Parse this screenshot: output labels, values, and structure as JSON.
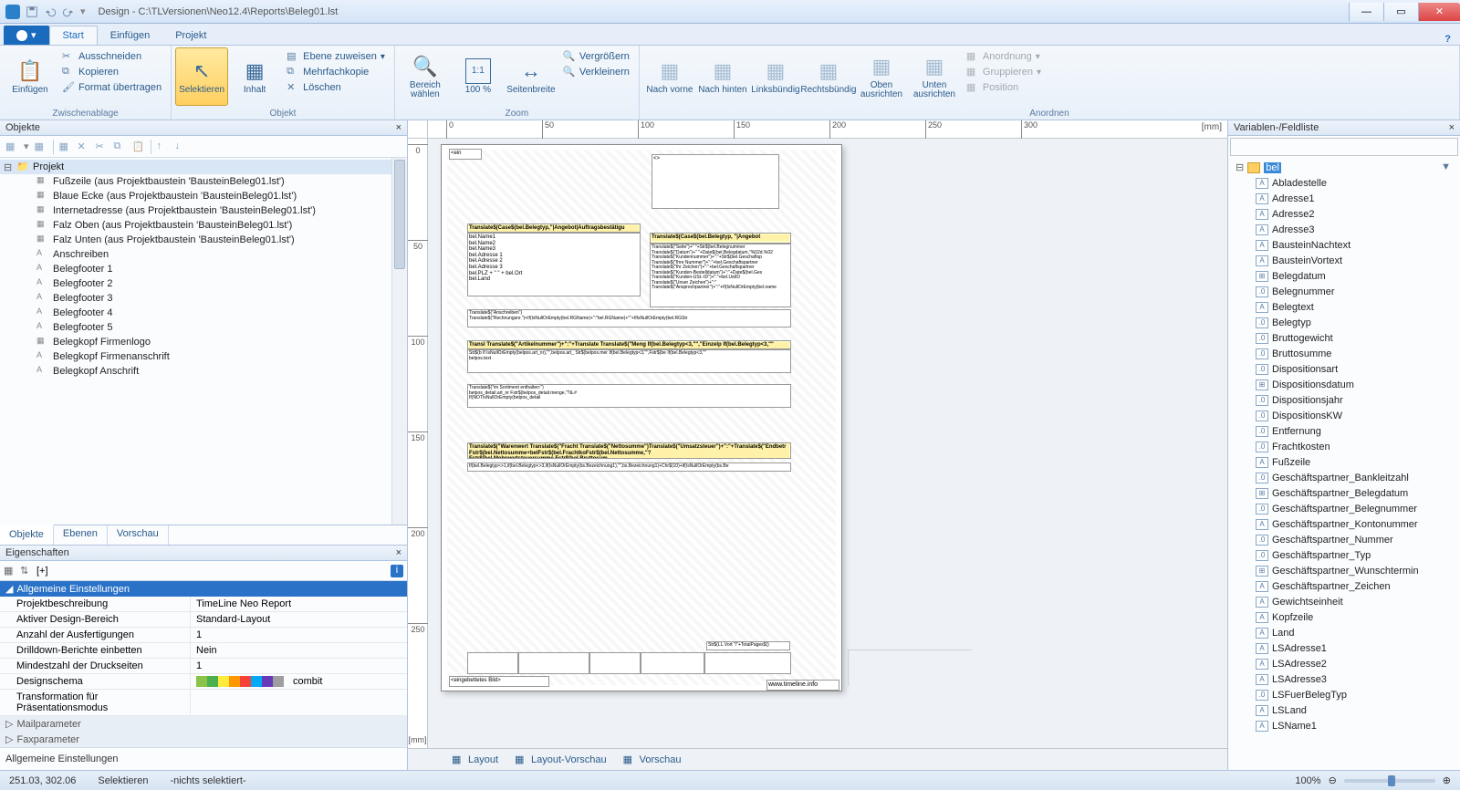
{
  "title": "Design - C:\\TLVersionen\\Neo12.4\\Reports\\Beleg01.lst",
  "tabs": {
    "file": "",
    "start": "Start",
    "einf": "Einfügen",
    "proj": "Projekt"
  },
  "ribbon": {
    "groups": {
      "zwischen": "Zwischenablage",
      "objekt": "Objekt",
      "zoom": "Zoom",
      "anordnen": "Anordnen"
    },
    "einfuegen": "Einfügen",
    "auss": "Ausschneiden",
    "kopieren": "Kopieren",
    "format": "Format übertragen",
    "selekt": "Selektieren",
    "inhalt": "Inhalt",
    "ebene": "Ebene zuweisen",
    "mehrfach": "Mehrfachkopie",
    "loeschen": "Löschen",
    "bereich": "Bereich\nwählen",
    "hundert": "100\n%",
    "seitenb": "Seitenbreite",
    "vergr": "Vergrößern",
    "verkl": "Verkleinern",
    "nvorne": "Nach\nvorne",
    "nhinten": "Nach\nhinten",
    "linksb": "Linksbündig",
    "rechtsb": "Rechtsbündig",
    "obena": "Oben\nausrichten",
    "untena": "Unten\nausrichten",
    "anord": "Anordnung",
    "grupp": "Gruppieren",
    "posit": "Position"
  },
  "leftPanel": {
    "title": "Objekte",
    "tabs": {
      "obj": "Objekte",
      "eb": "Ebenen",
      "vor": "Vorschau"
    },
    "root": "Projekt",
    "items": [
      "Fußzeile (aus Projektbaustein 'BausteinBeleg01.lst')",
      "Blaue Ecke (aus Projektbaustein 'BausteinBeleg01.lst')",
      "Internetadresse (aus Projektbaustein 'BausteinBeleg01.lst')",
      "Falz Oben (aus Projektbaustein 'BausteinBeleg01.lst')",
      "Falz Unten (aus Projektbaustein 'BausteinBeleg01.lst')",
      "Anschreiben",
      "Belegfooter 1",
      "Belegfooter 2",
      "Belegfooter 3",
      "Belegfooter 4",
      "Belegfooter 5",
      "Belegkopf Firmenlogo",
      "Belegkopf Firmenanschrift",
      "Belegkopf Anschrift"
    ]
  },
  "props": {
    "title": "Eigenschaften",
    "sort": "[+]",
    "group": "Allgemeine Einstellungen",
    "rows": [
      {
        "k": "Projektbeschreibung",
        "v": "TimeLine Neo Report"
      },
      {
        "k": "Aktiver Design-Bereich",
        "v": "Standard-Layout"
      },
      {
        "k": "Anzahl der Ausfertigungen",
        "v": "1"
      },
      {
        "k": "Drilldown-Berichte einbetten",
        "v": "Nein"
      },
      {
        "k": "Mindestzahl der Druckseiten",
        "v": "1"
      },
      {
        "k": "Designschema",
        "v": "combit"
      },
      {
        "k": "Transformation für Präsentationsmodus",
        "v": ""
      }
    ],
    "mail": "Mailparameter",
    "fax": "Faxparameter",
    "foot": "Allgemeine Einstellungen"
  },
  "canvas": {
    "tabs": {
      "layout": "Layout",
      "lvor": "Layout-Vorschau",
      "vor": "Vorschau"
    },
    "unit": "[mm]",
    "hticks": [
      "0",
      "50",
      "100",
      "150",
      "200",
      "250",
      "300"
    ],
    "vticks": [
      "0",
      "50",
      "100",
      "150",
      "200",
      "250"
    ],
    "tag": "<ein",
    "tag2": "<>",
    "title1": "Translate$(Case$(bel.Belegtyp,\"|Angebot|Auftragsbestätigu",
    "title2": "Translate$(Case$(bel.Belegtyp, \"|Angebot",
    "addr": "bel.Name1\nbel.Name2\nbel.Name3\nbel.Adresse 1\nbel.Adresse 2\nbel.Adresse 3\nbel.PLZ + \" \" + bel.Ort\nbel.Land",
    "meta": "Translate$(\"Seite\")+\" \"+Str$(bel.Belegnummer\nTranslate$(\"Datum\")+\" \"+Date$(bel.Belegdatum,\"%02d.%02\nTranslate$(\"Kundennummer\")+\":\"+Str$(bel.Geschaftsp\nTranslate$(\"Ihre Nummer\")+\":\"+bel.Geschaftspartner\nTranslate$(\"Ihr Zeichen\")+\":\"+bel.Geschaftspartner\nTranslate$(\"Kunden-Bestelldatum\")+\":\"+Date$(bel.Ges\nTranslate$(\"Kunden-USt.-ID\")+\":\"+bel.UstID\nTranslate$(\"Unser Zeichen\")+\":\"\nTranslate$(\"Ansprechpartner\")+\":\"+If(IsNullOrEmpty(bel.name",
    "ansch": "Translate$(\"Anschreiben\")\nTranslate$(\"Rechnungsnr.\")+If(IsNullOrEmpty(bel.RGName)+\":\"bel.RGName)+\"\"+IfIsNullOrEmpty(bel.RGStr",
    "table_hdr": "Transl  Translate$(\"Artikelnummer\")+\":\"+Translate  Translate$(\"Meng  If(bel.Belegtyp<3,\"\",\"Einzelp  If(bel.Belegtyp<3,\"\"",
    "row1": "Str$(b  If IsNullOrEmpty(belpos.art_nr),\"\",belpos.art_  Str$(belpos.mer  If(bel.Belegtyp<3,\"\",Fstr$(be  If(bel.Belegtyp<3,\"\"\n        belpos.text",
    "row2": "        Translate$(\"im Sortiment enthalten:\")\n        belpos_detail.art_nr                    Fstr$(belpos_detail.menge,\"?&.#\n        If(NOTIsNullOrEmpty(belpos_detail",
    "sumrow": "Translate$(\"Warenwert  Translate$(\"Fracht  Translate$(\"Nettosumme\")Translate$(\"Umsatzsteuer\")+\":\"+Translate$(\"Endbetr\nFstr$(bel.Nettosumme+belFstr$(bel.FrachtkoFstr$(bel.Nettosumme,\"?Fstr$(bel.Mehrwertsteuersumme,Fstr$(bel.Bruttosum",
    "condrow": "If(bel.Belegtyp<>1,if(bel.Belegtyp<>3,if(IsNullOrEmpty(bs.Bezeichnung1),\"\",bs.Bezeichnung1)+Chr$(10)+if(IsNullOrEmpty(bs.Be",
    "footR": "Str$(LL.Vort  \"/\"+TotalPages$()",
    "imgbox": "<eingebettetes Bild>",
    "url": "www.timeline.info"
  },
  "rightPanel": {
    "title": "Variablen-/Feldliste",
    "search": "bel",
    "items": [
      {
        "t": "A",
        "n": "Abladestelle"
      },
      {
        "t": "A",
        "n": "Adresse1"
      },
      {
        "t": "A",
        "n": "Adresse2"
      },
      {
        "t": "A",
        "n": "Adresse3"
      },
      {
        "t": "A",
        "n": "BausteinNachtext"
      },
      {
        "t": "A",
        "n": "BausteinVortext"
      },
      {
        "t": "D",
        "n": "Belegdatum"
      },
      {
        "t": "N",
        "n": "Belegnummer"
      },
      {
        "t": "A",
        "n": "Belegtext"
      },
      {
        "t": "N",
        "n": "Belegtyp"
      },
      {
        "t": "N",
        "n": "Bruttogewicht"
      },
      {
        "t": "N",
        "n": "Bruttosumme"
      },
      {
        "t": "N",
        "n": "Dispositionsart"
      },
      {
        "t": "D",
        "n": "Dispositionsdatum"
      },
      {
        "t": "N",
        "n": "Dispositionsjahr"
      },
      {
        "t": "N",
        "n": "DispositionsKW"
      },
      {
        "t": "N",
        "n": "Entfernung"
      },
      {
        "t": "N",
        "n": "Frachtkosten"
      },
      {
        "t": "A",
        "n": "Fußzeile"
      },
      {
        "t": "N",
        "n": "Geschäftspartner_Bankleitzahl"
      },
      {
        "t": "D",
        "n": "Geschäftspartner_Belegdatum"
      },
      {
        "t": "N",
        "n": "Geschäftspartner_Belegnummer"
      },
      {
        "t": "A",
        "n": "Geschäftspartner_Kontonummer"
      },
      {
        "t": "N",
        "n": "Geschäftspartner_Nummer"
      },
      {
        "t": "N",
        "n": "Geschäftspartner_Typ"
      },
      {
        "t": "D",
        "n": "Geschäftspartner_Wunschtermin"
      },
      {
        "t": "A",
        "n": "Geschäftspartner_Zeichen"
      },
      {
        "t": "A",
        "n": "Gewichtseinheit"
      },
      {
        "t": "A",
        "n": "Kopfzeile"
      },
      {
        "t": "A",
        "n": "Land"
      },
      {
        "t": "A",
        "n": "LSAdresse1"
      },
      {
        "t": "A",
        "n": "LSAdresse2"
      },
      {
        "t": "A",
        "n": "LSAdresse3"
      },
      {
        "t": "N",
        "n": "LSFuerBelegTyp"
      },
      {
        "t": "A",
        "n": "LSLand"
      },
      {
        "t": "A",
        "n": "LSName1"
      }
    ]
  },
  "status": {
    "pos": "251.03, 302.06",
    "mode": "Selektieren",
    "sel": "-nichts selektiert-",
    "zoom": "100%"
  },
  "swatchColors": [
    "#8bc34a",
    "#4caf50",
    "#ffeb3b",
    "#ff9800",
    "#f44336",
    "#03a9f4",
    "#673ab7",
    "#9e9e9e"
  ]
}
